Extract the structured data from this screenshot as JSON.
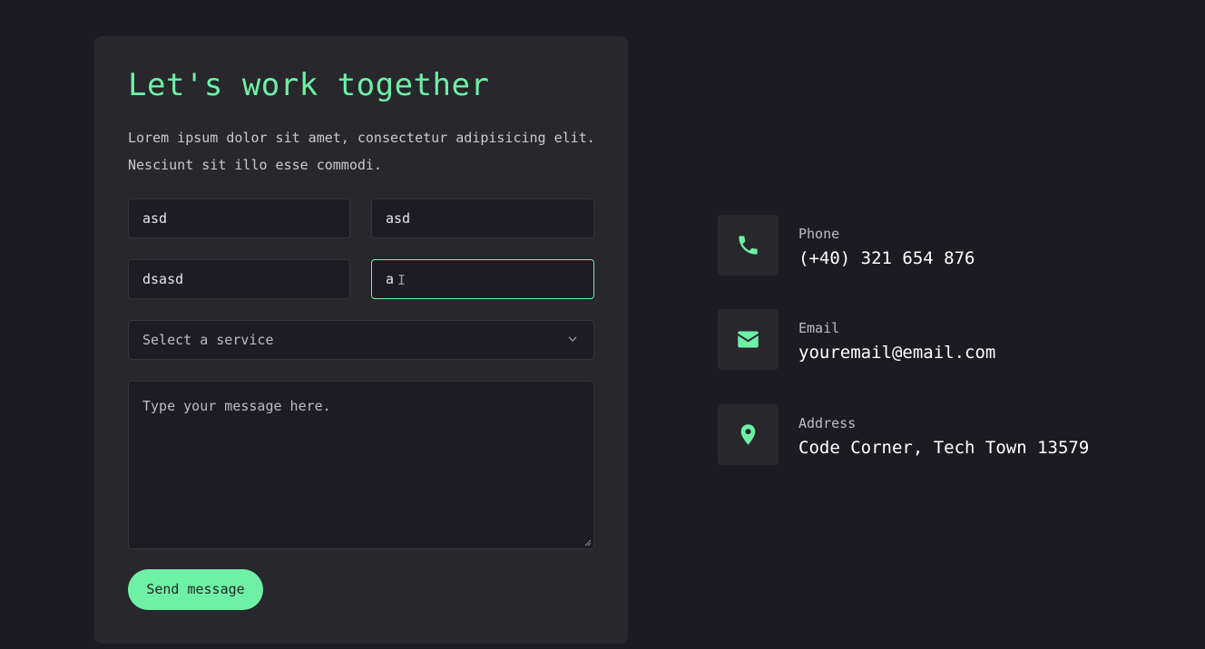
{
  "form": {
    "title": "Let's work together",
    "description": "Lorem ipsum dolor sit amet, consectetur adipisicing elit. Nesciunt sit illo esse commodi.",
    "fields": {
      "first_name_value": "asd",
      "last_name_value": "asd",
      "email_value": "dsasd",
      "phone_value": "a"
    },
    "service_select": {
      "selected_label": "Select a service"
    },
    "message": {
      "placeholder": "Type your message here."
    },
    "send_label": "Send message"
  },
  "contact_info": [
    {
      "icon": "phone-icon",
      "label": "Phone",
      "value": "(+40) 321 654 876"
    },
    {
      "icon": "envelope-icon",
      "label": "Email",
      "value": "youremail@email.com"
    },
    {
      "icon": "map-pin-icon",
      "label": "Address",
      "value": "Code Corner, Tech Town 13579"
    }
  ],
  "colors": {
    "accent": "#6ef0a6",
    "background": "#1c1b22",
    "card": "#27272c",
    "input": "#1d1c23"
  }
}
